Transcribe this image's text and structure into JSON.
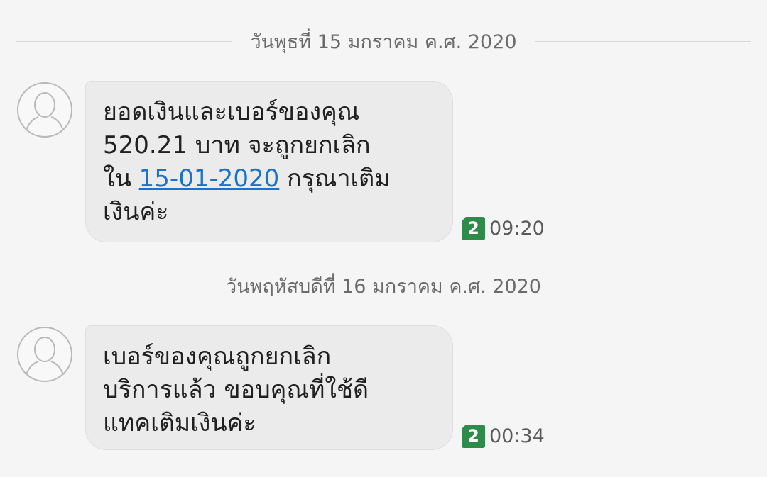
{
  "conversation": {
    "dates": [
      "วันพุธที่ 15 มกราคม ค.ศ. 2020",
      "วันพฤหัสบดีที่ 16 มกราคม ค.ศ. 2020"
    ],
    "messages": [
      {
        "line1": "ยอดเงินและเบอร์ของคุณ",
        "line2": "520.21 บาท จะถูกยกเลิก",
        "line3_prefix": "ใน ",
        "line3_link": "15-01-2020",
        "line3_suffix": " กรุณาเติม",
        "line4": "เงินค่ะ",
        "sim": "2",
        "time": "09:20"
      },
      {
        "line1": "เบอร์ของคุณถูกยกเลิก",
        "line2": "บริการแล้ว ขอบคุณที่ใช้ดี",
        "line3": "แทคเติมเงินค่ะ",
        "sim": "2",
        "time": "00:34"
      }
    ]
  },
  "colors": {
    "background": "#f5f5f5",
    "bubble": "#ebebeb",
    "link": "#1a73c9",
    "sim_badge": "#2e8b4a"
  },
  "icons": {
    "avatar": "person-placeholder-icon",
    "sim": "sim-card-icon"
  }
}
